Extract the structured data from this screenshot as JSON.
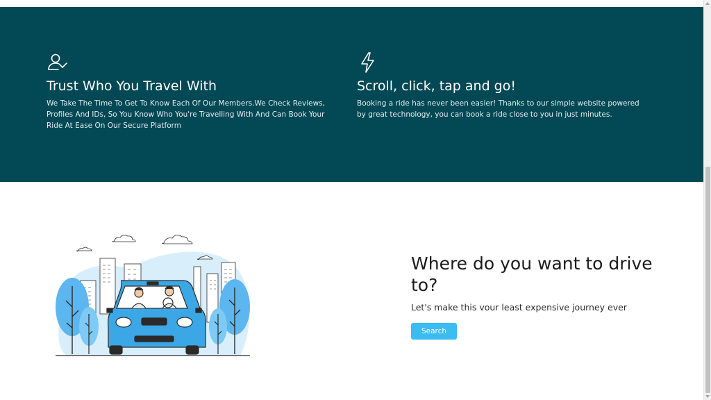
{
  "features": [
    {
      "icon": "user-check-icon",
      "title": "Trust Who You Travel With",
      "text": "We Take The Time To Get To Know Each Of Our Members.We Check Reviews, Profiles And IDs, So You Know Who You're Travelling With And Can Book Your Ride At Ease On Our Secure Platform"
    },
    {
      "icon": "lightning-icon",
      "title": "Scroll, click, tap and go!",
      "text": "Booking a ride has never been easier! Thanks to our simple website powered by great technology, you can book a ride close to you in just minutes."
    }
  ],
  "cta": {
    "illustration": "car-ride-illustration",
    "heading": "Where do you want to drive to?",
    "subtext": "Let's make this vour least expensive journey ever",
    "button_label": "Search"
  },
  "colors": {
    "features_bg": "#034855",
    "button": "#3bbcf3",
    "car": "#3ba7e6"
  }
}
